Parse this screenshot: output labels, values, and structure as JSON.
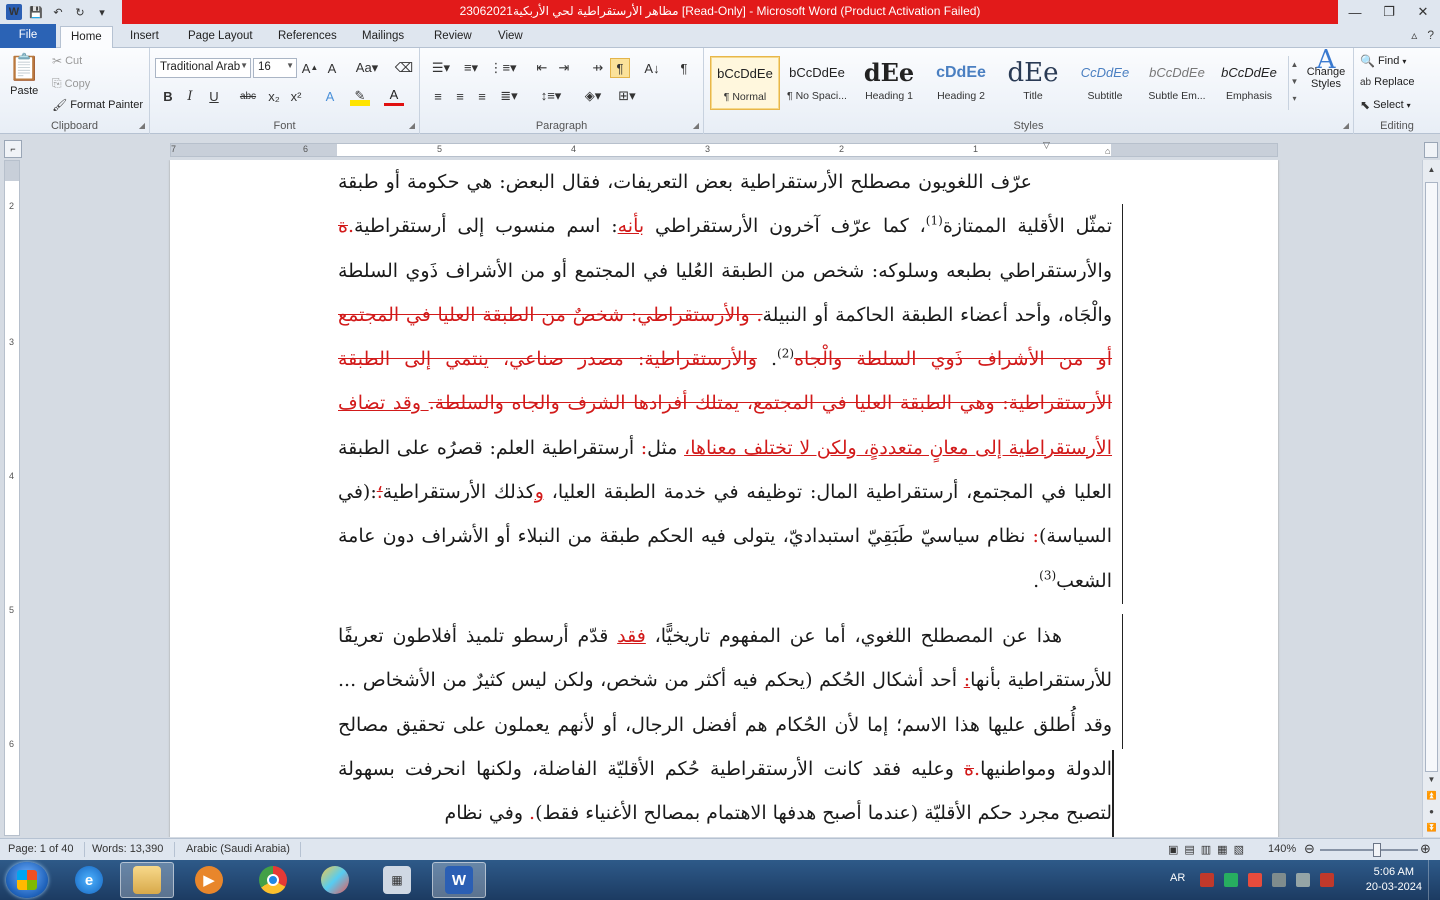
{
  "window": {
    "title": "مظاهر الأرستقراطية لحي الأربكية23062021 [Read-Only]  -  Microsoft Word (Product Activation Failed)",
    "word_icon": "W",
    "controls": [
      "—",
      "❐",
      "✕"
    ]
  },
  "tabs": [
    "File",
    "Home",
    "Insert",
    "Page Layout",
    "References",
    "Mailings",
    "Review",
    "View"
  ],
  "active_tab": "Home",
  "clipboard": {
    "paste": "Paste",
    "cut": "Cut",
    "copy": "Copy",
    "format_painter": "Format Painter",
    "label": "Clipboard"
  },
  "font": {
    "family": "Traditional Arab",
    "size": "16",
    "label": "Font",
    "buttons": [
      "B",
      "I",
      "U",
      "abc",
      "x₂",
      "x²"
    ]
  },
  "paragraph": {
    "label": "Paragraph"
  },
  "styles": {
    "label": "Styles",
    "items": [
      {
        "preview": "bCcDdEe",
        "name": "¶ Normal"
      },
      {
        "preview": "bCcDdEe",
        "name": "¶ No Spaci..."
      },
      {
        "preview": "dEe",
        "name": "Heading 1"
      },
      {
        "preview": "cDdEe",
        "name": "Heading 2"
      },
      {
        "preview": "dEe",
        "name": "Title"
      },
      {
        "preview": "CcDdEe",
        "name": "Subtitle"
      },
      {
        "preview": "bCcDdEe",
        "name": "Subtle Em..."
      },
      {
        "preview": "bCcDdEe",
        "name": "Emphasis"
      }
    ],
    "change_styles": "Change Styles"
  },
  "editing": {
    "label": "Editing",
    "find": "Find",
    "replace": "Replace",
    "select": "Select"
  },
  "ruler": {
    "h_numbers": [
      "7",
      "6",
      "5",
      "4",
      "3",
      "2",
      "1"
    ],
    "v_numbers": [
      "2",
      "3",
      "4",
      "5",
      "6"
    ]
  },
  "document": {
    "p1": [
      {
        "t": "عرّف اللغويون مصطلح الأرستقراطية بعض التعريفات، فقال البعض: هي حكومة أو طبقة تمثّل الأقلية الممتازة",
        "s": "n"
      },
      {
        "t": "(1)",
        "s": "sup"
      },
      {
        "t": "، كما عرّف آخرون الأرستقراطي ",
        "s": "n"
      },
      {
        "t": "بأنه",
        "s": "ins"
      },
      {
        "t": ": اسم منسوب إلى أرستقراطية",
        "s": "n"
      },
      {
        "t": ".",
        "s": "red"
      },
      {
        "t": "ة",
        "s": "del"
      },
      {
        "t": " والأرستقراطي بطبعه وسلوكه: شخص من الطبقة العُليا في المجتمع أو من الأشراف ذَوي السلطة والْجَاه، وأحد أعضاء الطبقة الحاكمة أو النبيلة",
        "s": "n"
      },
      {
        "t": ". والأرستقراطي: شخصٌ من الطبقة العليا في المجتمع أو من الأشراف ذَوي السلطة والْجاه",
        "s": "del"
      },
      {
        "t": "(2)",
        "s": "sup"
      },
      {
        "t": ". ",
        "s": "n"
      },
      {
        "t": "والأرستقراطية: مصدر صناعي، ينتمي إلى الطبقة الأرستقراطية: وهي الطبقة العليا في المجتمع، يمتلك أفرادها الشرف والجاه والسلطة.",
        "s": "del"
      },
      {
        "t": " وقد تضاف الأرستقراطية إلى معانٍ متعددةٍ، ولكن لا تختلف معناها،",
        "s": "ins"
      },
      {
        "t": " مثل",
        "s": "n"
      },
      {
        "t": ":",
        "s": "red"
      },
      {
        "t": " أرستقراطية العلم: قصرُه على الطبقة العليا في المجتمع، أرستقراطية المال: توظيفه في خدمة الطبقة العليا، ",
        "s": "n"
      },
      {
        "t": "و",
        "s": "ins"
      },
      {
        "t": "كذلك الأرستقراطية",
        "s": "n"
      },
      {
        "t": "؛",
        "s": "del"
      },
      {
        "t": ":(في السياسة)",
        "s": "n"
      },
      {
        "t": ":",
        "s": "red"
      },
      {
        "t": " نظام سياسيّ طَبَقِيّ استبداديّ، يتولى فيه الحكم طبقة من النبلاء أو الأشراف دون عامة الشعب",
        "s": "n"
      },
      {
        "t": "(3)",
        "s": "sup"
      },
      {
        "t": ".",
        "s": "n"
      }
    ],
    "p2": [
      {
        "t": "هذا عن المصطلح اللغوي، أما عن المفهوم تاريخيًّا، ",
        "s": "n"
      },
      {
        "t": "فقد",
        "s": "ins"
      },
      {
        "t": " قدّم أرسطو تلميذ أفلاطون تعريفًا للأرستقراطية بأنها",
        "s": "n"
      },
      {
        "t": ":",
        "s": "ins"
      },
      {
        "t": " أحد أشكال الحُكم (يحكم فيه أكثر من شخص، ولكن ليس كثيرٌ من الأشخاص ... وقد أُطلق عليها هذا الاسم؛ إما لأن الحُكام هم أفضل الرجال، أو لأنهم يعملون على تحقيق مصالح الدولة ومواطنيها",
        "s": "n"
      },
      {
        "t": ".",
        "s": "red"
      },
      {
        "t": "ة",
        "s": "del"
      },
      {
        "t": " وعليه فقد كانت الأرستقراطية حُكم الأقليّة الفاضلة، ولكنها انحرفت بسهولة لتصبح مجرد حكم الأقليّة (عندما أصبح هدفها الاهتمام بمصالح الأغنياء فقط)",
        "s": "n"
      },
      {
        "t": ".",
        "s": "red"
      },
      {
        "t": " وفي نظام",
        "s": "n"
      }
    ]
  },
  "statusbar": {
    "page": "Page: 1 of 40",
    "words": "Words: 13,390",
    "language": "Arabic (Saudi Arabia)",
    "zoom": "140%",
    "zoom_fraction": 0.58
  },
  "taskbar": {
    "apps": [
      "internet-explorer",
      "file-explorer",
      "media-player",
      "chrome",
      "paint",
      "calculator",
      "word"
    ],
    "lang": "AR",
    "time": "5:06 AM",
    "date": "20-03-2024"
  },
  "colors": {
    "accent": "#2b63b5",
    "titlebar": "#e21a1a",
    "revision": "#d21a1a"
  }
}
